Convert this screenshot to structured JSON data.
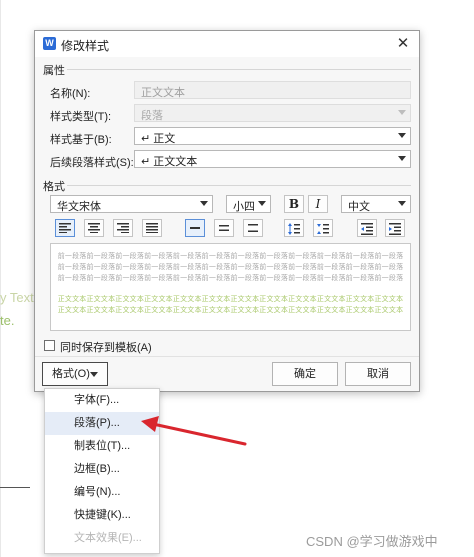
{
  "background": {
    "fragment_1": "y Text",
    "fragment_2": "te."
  },
  "dialog": {
    "title": "修改样式",
    "app_icon_glyph": "W",
    "properties": {
      "section_title": "属性",
      "name_label": "名称(N):",
      "name_value": "正文文本",
      "style_type_label": "样式类型(T):",
      "style_type_value": "段落",
      "based_on_label": "样式基于(B):",
      "based_on_value": "↵ 正文",
      "next_style_label": "后续段落样式(S):",
      "next_style_value": "↵ 正文文本"
    },
    "format": {
      "section_title": "格式",
      "font_name": "华文宋体",
      "font_size": "小四",
      "bold_glyph": "B",
      "italic_glyph": "I",
      "language": "中文"
    },
    "preview": {
      "line_gray": "前一段落前一段落前一段落前一段落前一段落前一段落前一段落前一段落前一段落前一段落前一段落前一段落",
      "line_green": "正文文本正文文本正文文本正文文本正文文本正文文本正文文本正文文本正文文本正文文本正文文本正文文本"
    },
    "save_to_template_label": "同时保存到模板(A)",
    "format_button_label": "格式(O)",
    "ok_label": "确定",
    "cancel_label": "取消"
  },
  "format_menu": {
    "items": [
      {
        "label": "字体(F)..."
      },
      {
        "label": "段落(P)..."
      },
      {
        "label": "制表位(T)..."
      },
      {
        "label": "边框(B)..."
      },
      {
        "label": "编号(N)..."
      },
      {
        "label": "快捷键(K)..."
      },
      {
        "label": "文本效果(E)..."
      }
    ],
    "highlighted_index": 1,
    "disabled_index": 6
  },
  "colors": {
    "annotation_arrow": "#d9262e",
    "accent": "#2b6bd6"
  },
  "watermark": "CSDN @学习做游戏中"
}
